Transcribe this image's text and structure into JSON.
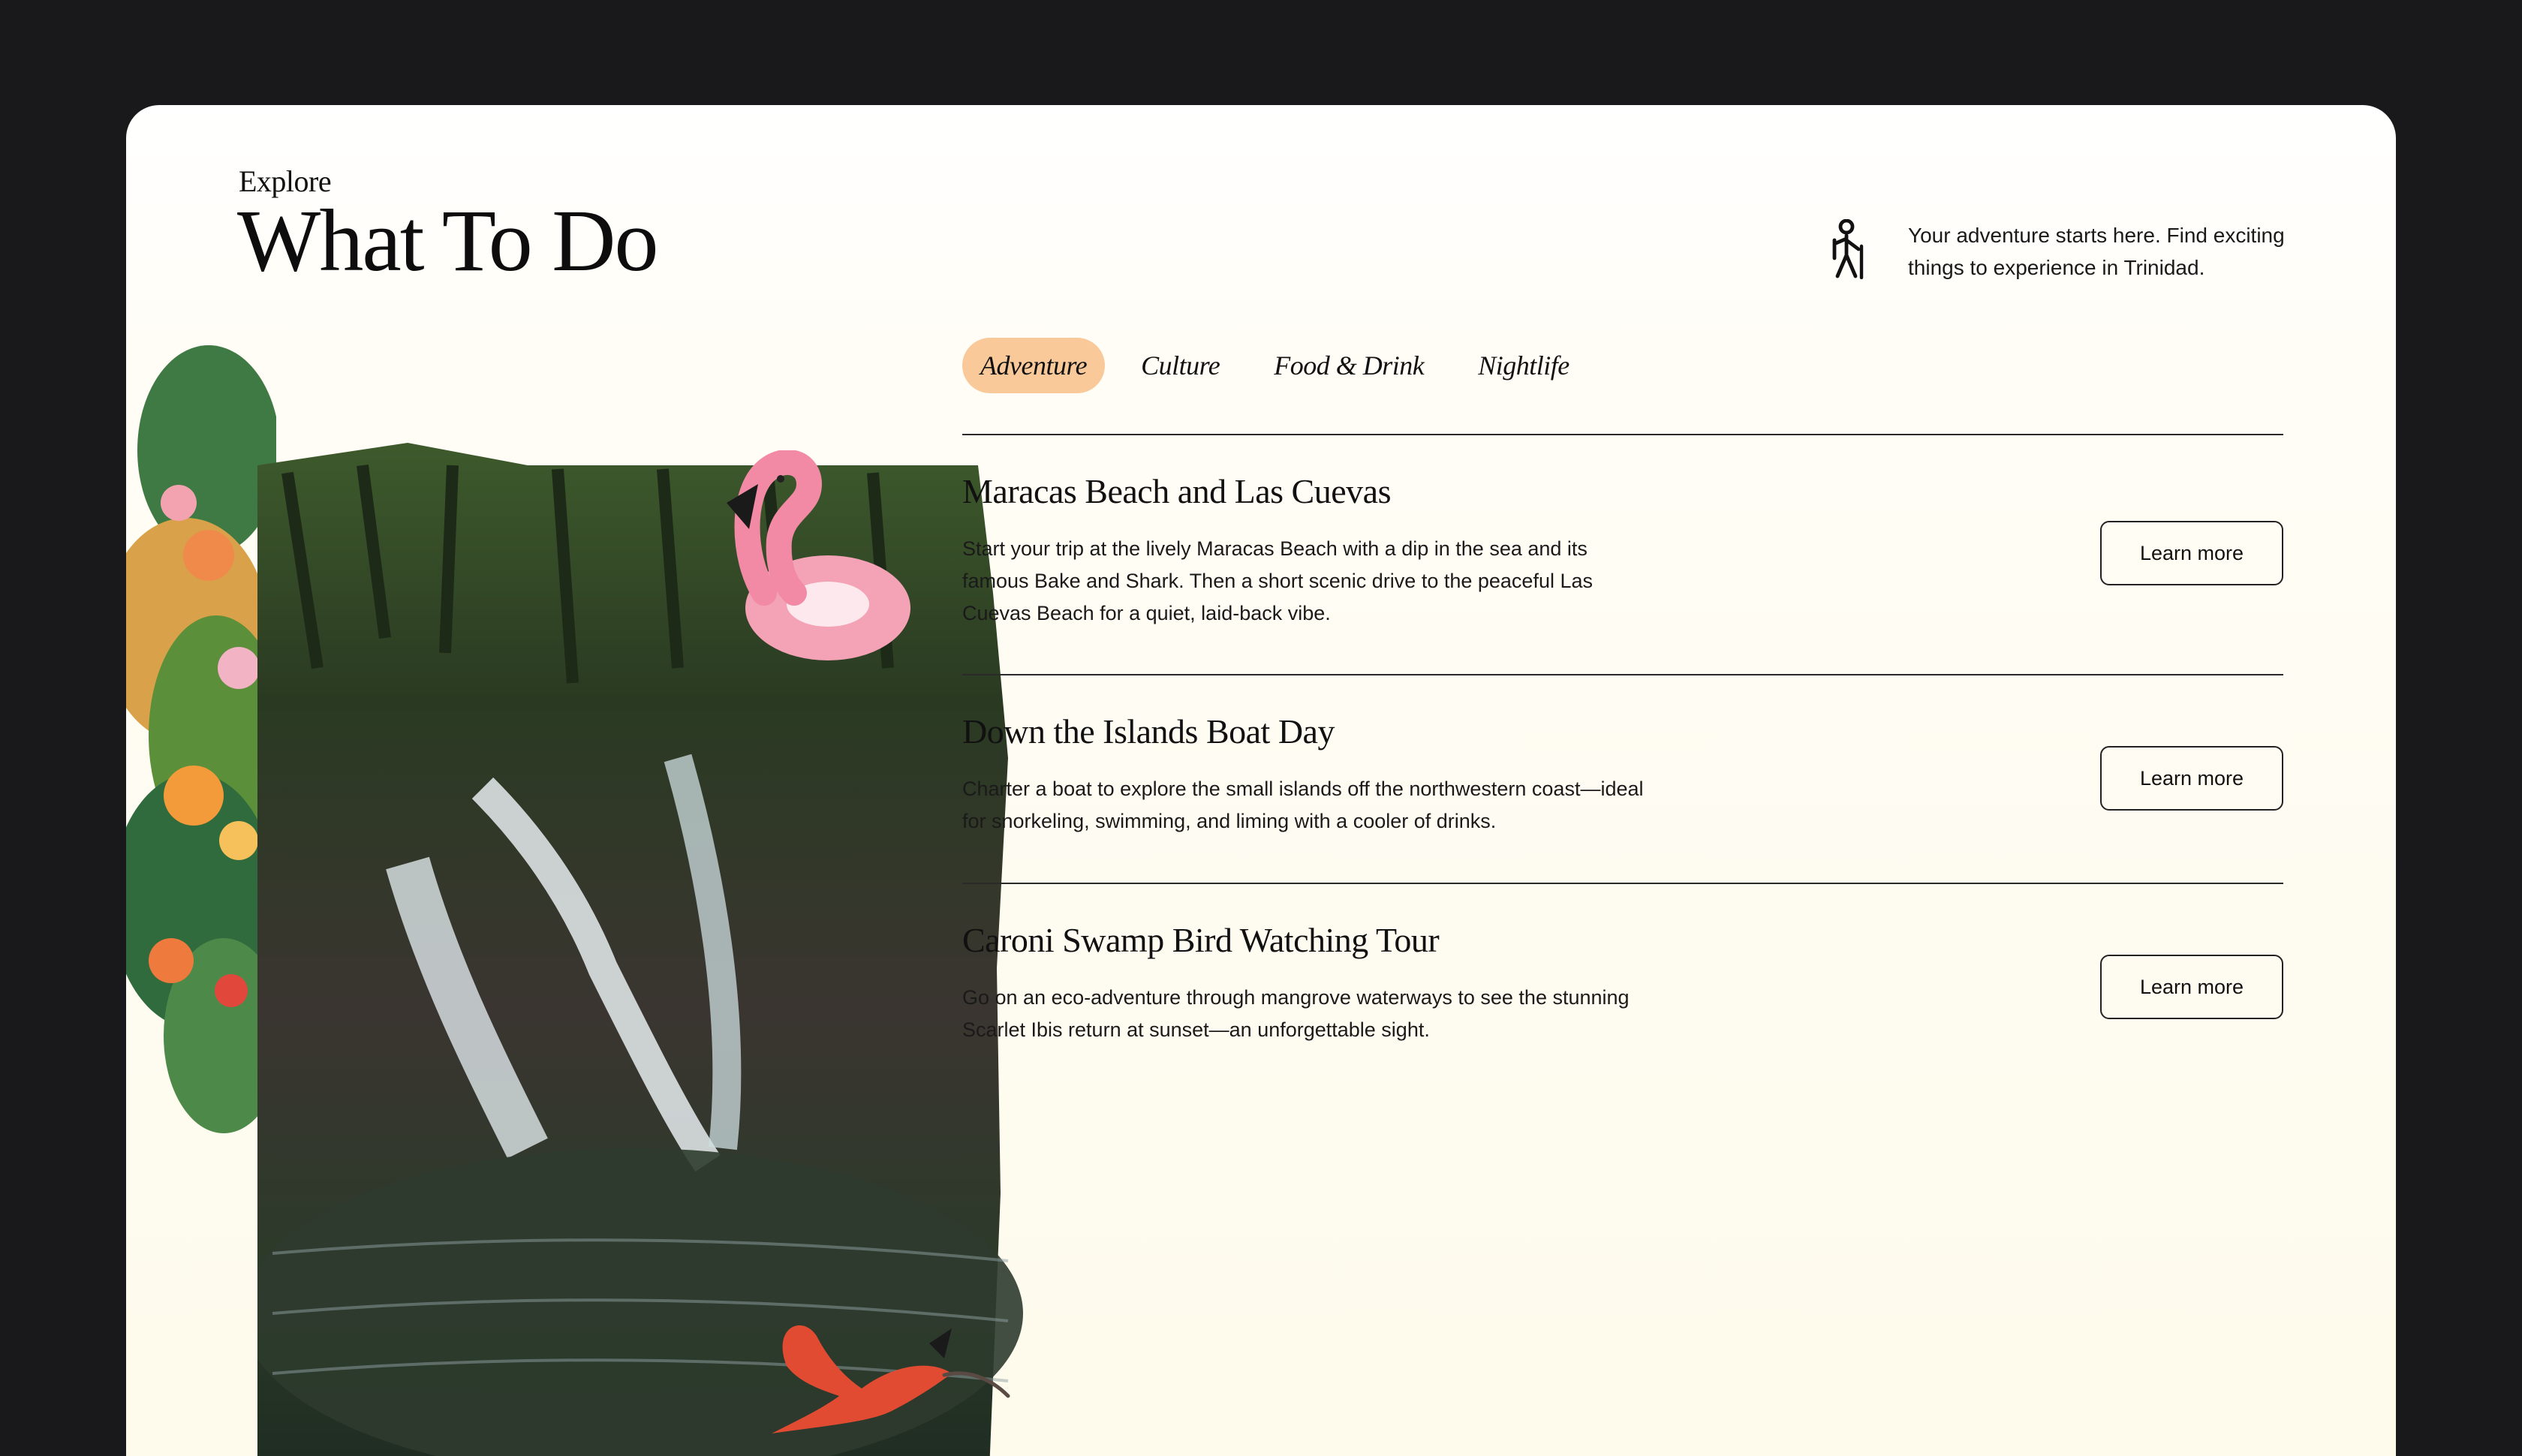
{
  "header": {
    "eyebrow": "Explore",
    "title": "What To Do",
    "intro": "Your adventure starts here. Find exciting things to experience in Trinidad.",
    "intro_icon": "hiker-icon"
  },
  "tabs": [
    {
      "label": "Adventure",
      "active": true
    },
    {
      "label": "Culture",
      "active": false
    },
    {
      "label": "Food & Drink",
      "active": false
    },
    {
      "label": "Nightlife",
      "active": false
    }
  ],
  "activities": [
    {
      "title": "Maracas Beach and Las Cuevas",
      "description": "Start your trip at the lively Maracas Beach with a dip in the sea and its famous Bake and Shark. Then a short scenic drive to the peaceful Las Cuevas Beach for a quiet, laid-back vibe.",
      "button": "Learn more"
    },
    {
      "title": "Down the Islands Boat Day",
      "description": "Charter a boat to explore the small islands off the northwestern coast—ideal for snorkeling, swimming, and liming with a cooler of drinks.",
      "button": "Learn more"
    },
    {
      "title": "Caroni Swamp Bird Watching Tour",
      "description": "Go on an eco-adventure through mangrove waterways to see the stunning Scarlet Ibis return at sunset—an unforgettable sight.",
      "button": "Learn more"
    }
  ],
  "colors": {
    "background": "#19181b",
    "card": "#fffdf6",
    "tab_active": "#f9c99a",
    "text": "#111111"
  }
}
